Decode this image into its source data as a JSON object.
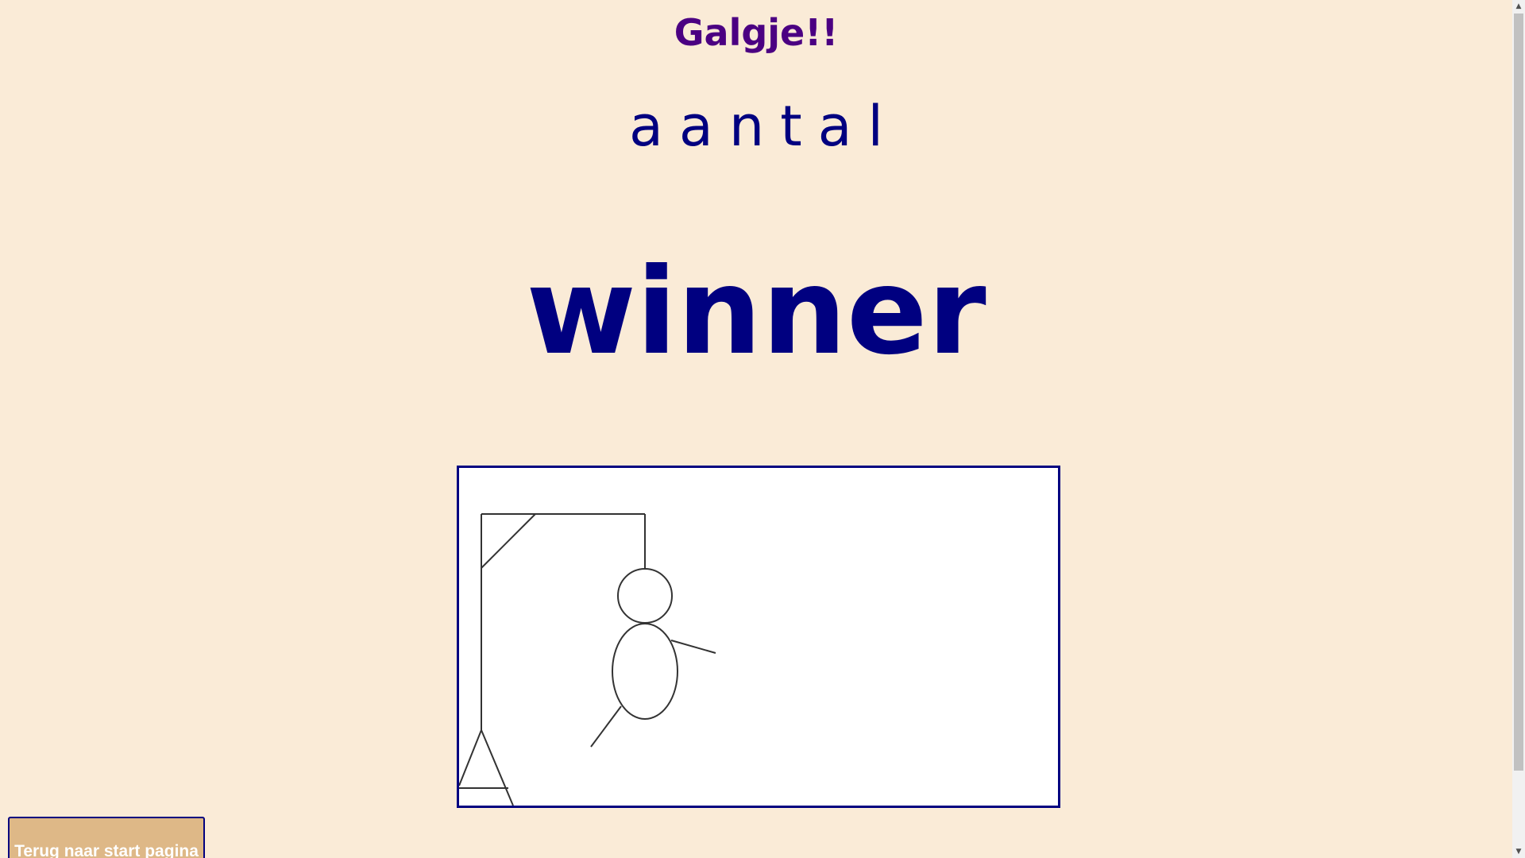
{
  "page": {
    "title": "Galgje!!",
    "result": "winner",
    "back_button_label": "Terug naar start pagina"
  },
  "word": {
    "letters": [
      "a",
      "a",
      "n",
      "t",
      "a",
      "l"
    ]
  },
  "colors": {
    "background": "#faebd7",
    "title": "#4b0082",
    "text": "#000080",
    "button_bg": "#deb887"
  },
  "icons": {
    "scroll_up": "chevron-up-icon",
    "scroll_down": "chevron-down-icon"
  }
}
